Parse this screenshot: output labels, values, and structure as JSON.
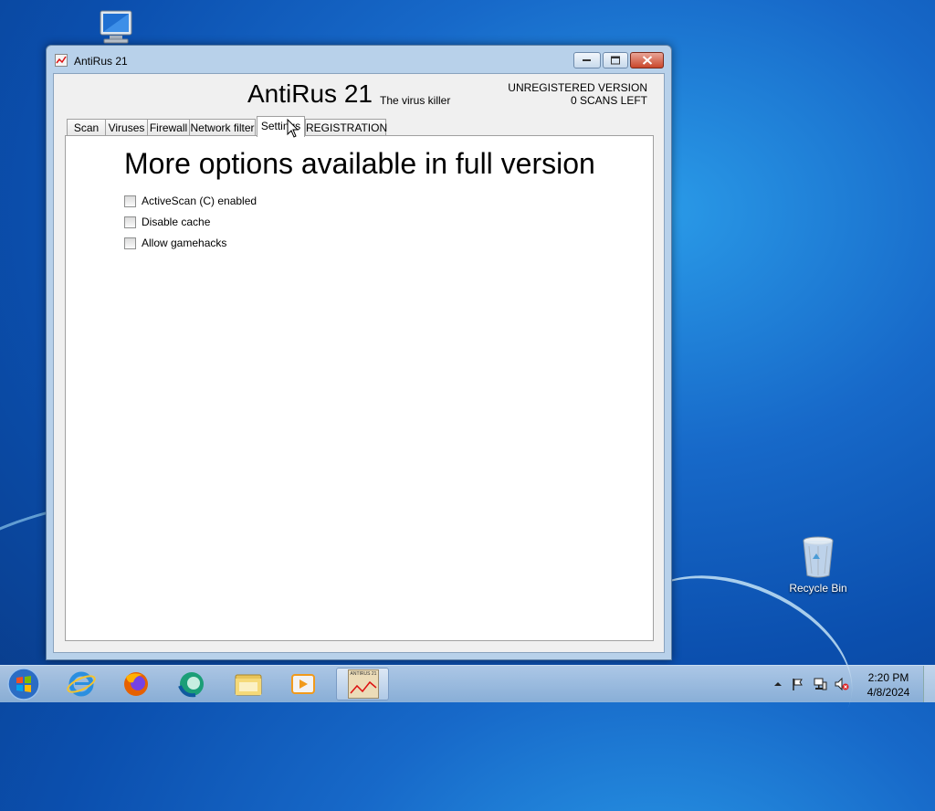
{
  "desktop": {
    "recycle_bin_label": "Recycle Bin"
  },
  "window": {
    "title": "AntiRus 21",
    "app_name": "AntiRus 21",
    "tagline": "The virus killer",
    "registration_status": "UNREGISTERED VERSION",
    "scans_left": "0 SCANS LEFT",
    "tabs": [
      {
        "label": "Scan"
      },
      {
        "label": "Viruses"
      },
      {
        "label": "Firewall"
      },
      {
        "label": "Network filter"
      },
      {
        "label": "Settings"
      },
      {
        "label": "REGISTRATION"
      }
    ],
    "active_tab": "Settings",
    "settings": {
      "heading": "More options available in full version",
      "options": [
        {
          "label": "ActiveScan (C) enabled",
          "checked": false
        },
        {
          "label": "Disable cache",
          "checked": false
        },
        {
          "label": "Allow gamehacks",
          "checked": false
        }
      ]
    }
  },
  "taskbar": {
    "active_app_label": "ANTIRUS 21",
    "clock_time": "2:20 PM",
    "clock_date": "4/8/2024"
  }
}
